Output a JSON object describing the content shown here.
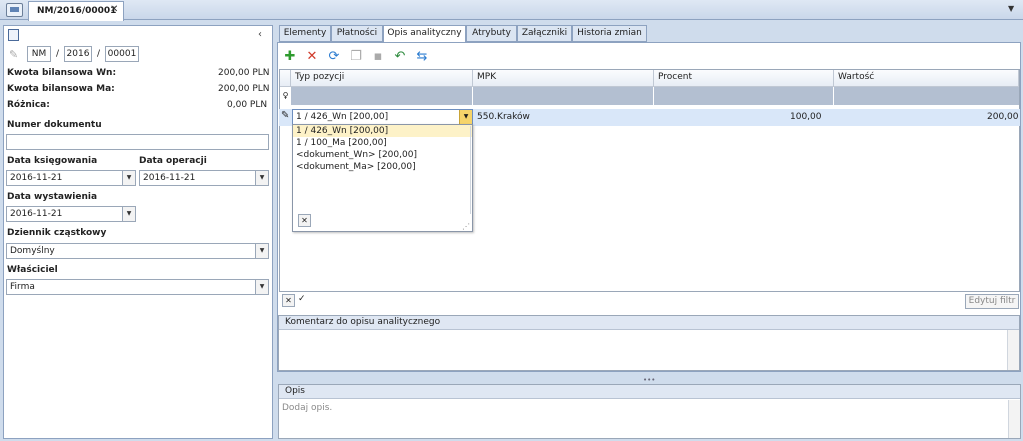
{
  "tab": {
    "title": "NM/2016/00001",
    "close": "✕"
  },
  "left": {
    "number": {
      "prefix": "NM",
      "year": "2016",
      "seq": "00001",
      "sep": "/"
    },
    "rows": [
      {
        "label": "Kwota bilansowa Wn:",
        "value": "200,00 PLN"
      },
      {
        "label": "Kwota bilansowa Ma:",
        "value": "200,00 PLN"
      },
      {
        "label": "Różnica:",
        "value": "0,00 PLN"
      }
    ],
    "numer_dokumentu": {
      "label": "Numer dokumentu",
      "value": ""
    },
    "data_ksiegowania": {
      "label": "Data księgowania",
      "value": "2016-11-21"
    },
    "data_operacji": {
      "label": "Data operacji",
      "value": "2016-11-21"
    },
    "data_wystawienia": {
      "label": "Data wystawienia",
      "value": "2016-11-21"
    },
    "dziennik": {
      "label": "Dziennik cząstkowy",
      "value": "Domyślny"
    },
    "wlasciciel": {
      "label": "Właściciel",
      "value": "Firma"
    }
  },
  "tabs": [
    "Elementy",
    "Płatności",
    "Opis analityczny",
    "Atrybuty",
    "Załączniki",
    "Historia zmian"
  ],
  "grid": {
    "columns": [
      "Typ pozycji",
      "MPK",
      "Procent",
      "Wartość"
    ],
    "row": {
      "typ": "1 / 426_Wn [200,00]",
      "mpk": "550.Kraków",
      "procent": "100,00",
      "wartosc": "200,00"
    },
    "dropdown": [
      "1 / 426_Wn [200,00]",
      "1 / 100_Ma [200,00]",
      "<dokument_Wn> [200,00]",
      "<dokument_Ma> [200,00]"
    ],
    "edit_filter": "Edytuj filtr"
  },
  "komentarz": {
    "title": "Komentarz do opisu analitycznego"
  },
  "opis": {
    "title": "Opis",
    "placeholder": "Dodaj opis."
  },
  "colors": {
    "accent": "#2a64b5",
    "row_selected": "#d9e7f9"
  }
}
